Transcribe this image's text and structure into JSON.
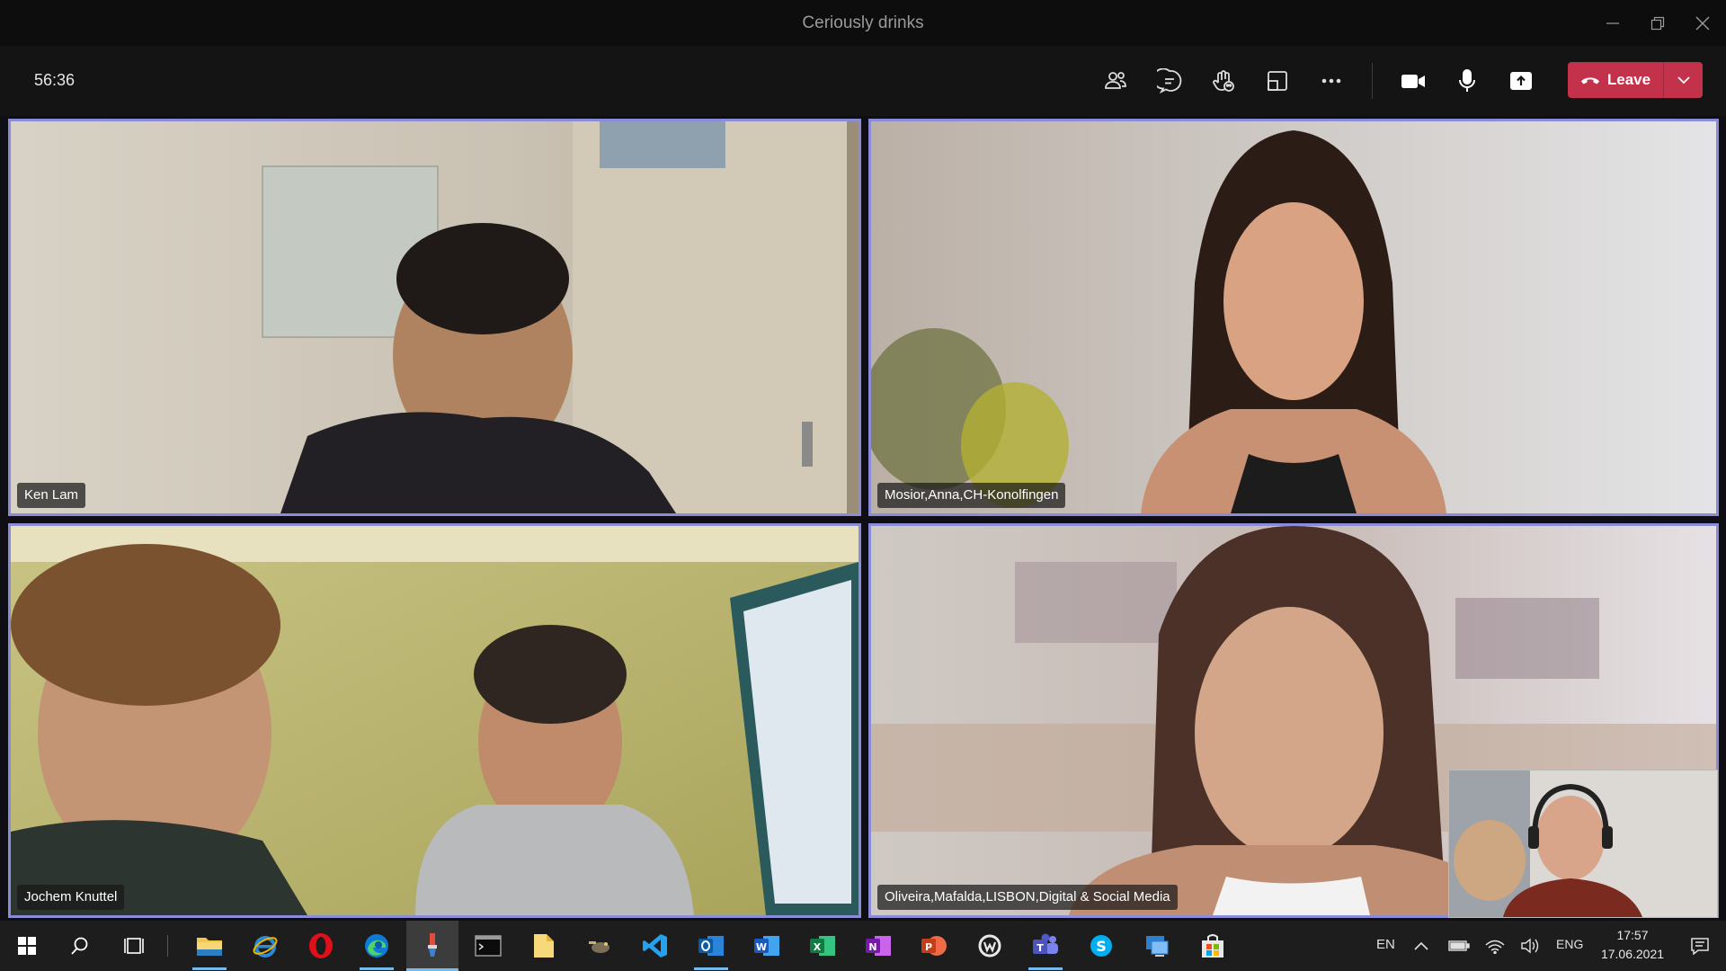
{
  "window": {
    "title": "Ceriously drinks",
    "controls": [
      "minimize-icon",
      "restore-icon",
      "close-icon"
    ]
  },
  "meeting": {
    "timer": "56:36",
    "toolbar_icons": [
      "people-icon",
      "chat-icon",
      "raise-hand-icon",
      "rooms-icon",
      "more-icon",
      "camera-icon",
      "microphone-icon",
      "share-icon"
    ],
    "leave_label": "Leave",
    "leave_color": "#c4314b",
    "active_tile_border": "#8b8cd6"
  },
  "participants": [
    {
      "name": "Ken Lam"
    },
    {
      "name": "Mosior,Anna,CH-Konolfingen"
    },
    {
      "name": "Jochem Knuttel"
    },
    {
      "name": "Oliveira,Mafalda,LISBON,Digital & Social Media"
    }
  ],
  "taskbar": {
    "apps": [
      "start-icon",
      "search-icon",
      "task-view-icon",
      "file-explorer-icon",
      "internet-explorer-icon",
      "opera-icon",
      "edge-icon",
      "paint-app-icon",
      "terminal-icon",
      "notes-app-icon",
      "game-app-icon",
      "vscode-icon",
      "outlook-icon",
      "word-icon",
      "excel-icon",
      "onenote-icon",
      "powerpoint-icon",
      "app-w-icon",
      "teams-icon",
      "skype-icon",
      "remote-desktop-icon",
      "store-icon"
    ],
    "tray": {
      "input_lang": "EN",
      "keyboard": "ENG",
      "time": "17:57",
      "date": "17.06.2021"
    }
  }
}
